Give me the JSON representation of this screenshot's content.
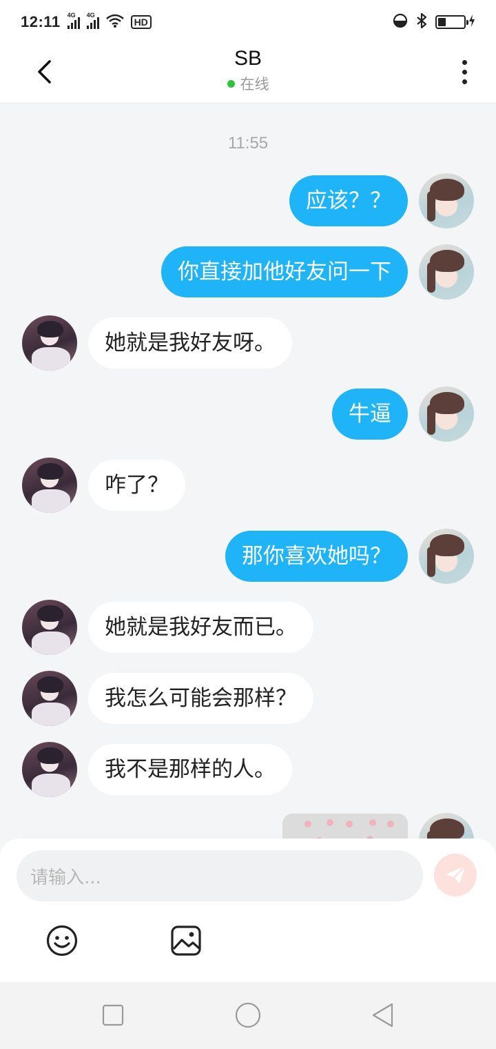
{
  "status_bar": {
    "time": "12:11",
    "signal1_label": "4G",
    "signal2_label": "4G",
    "hd_label": "HD",
    "battery_level": 0.3,
    "icons": [
      "wifi-icon",
      "hd-icon",
      "data-saver-icon",
      "bluetooth-icon",
      "battery-icon",
      "charging-icon"
    ]
  },
  "header": {
    "title": "SB",
    "presence": "在线",
    "presence_color": "#2ec23d",
    "icons": [
      "back-arrow-icon",
      "more-vertical-icon"
    ]
  },
  "chat": {
    "timestamp": "11:55",
    "outgoing_bubble_color": "#1eb4f7",
    "incoming_bubble_color": "#ffffff",
    "messages": [
      {
        "side": "out",
        "text": "应该？？"
      },
      {
        "side": "out",
        "text": "你直接加他好友问一下"
      },
      {
        "side": "in",
        "text": "她就是我好友呀。"
      },
      {
        "side": "out",
        "text": "牛逼"
      },
      {
        "side": "in",
        "text": "咋了？"
      },
      {
        "side": "out",
        "text": "那你喜欢她吗？"
      },
      {
        "side": "in",
        "text": "她就是我好友而已。"
      },
      {
        "side": "in",
        "text": "我怎么可能会那样？"
      },
      {
        "side": "in",
        "text": "我不是那样的人。"
      },
      {
        "side": "out",
        "type": "image",
        "text": ""
      }
    ]
  },
  "composer": {
    "placeholder": "请输入...",
    "send_color": "#fde1dc",
    "icons": [
      "send-icon",
      "emoji-icon",
      "image-icon"
    ]
  },
  "nav_bar": {
    "icons": [
      "recents-icon",
      "home-icon",
      "back-icon"
    ]
  }
}
